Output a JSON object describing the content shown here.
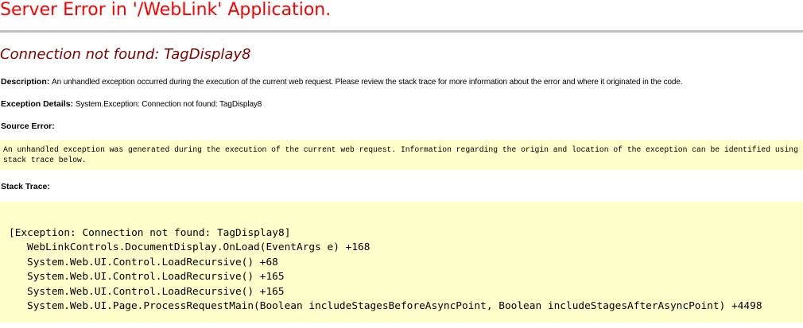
{
  "app_title": "Server Error in '/WebLink' Application.",
  "error_heading": "Connection not found: TagDisplay8",
  "description": {
    "label": "Description:",
    "text": "An unhandled exception occurred during the execution of the current web request. Please review the stack trace for more information about the error and where it originated in the code."
  },
  "exception_details": {
    "label": "Exception Details:",
    "text": "System.Exception: Connection not found: TagDisplay8"
  },
  "source_error": {
    "label": "Source Error:",
    "text": "An unhandled exception was generated during the execution of the current web request. Information regarding the origin and location of the exception can be identified using the exception stack trace below."
  },
  "stack_trace": {
    "label": "Stack Trace:",
    "exception_line": "[Exception: Connection not found: TagDisplay8]",
    "frames": [
      "WebLinkControls.DocumentDisplay.OnLoad(EventArgs e) +168",
      "System.Web.UI.Control.LoadRecursive() +68",
      "System.Web.UI.Control.LoadRecursive() +165",
      "System.Web.UI.Control.LoadRecursive() +165",
      "System.Web.UI.Page.ProcessRequestMain(Boolean includeStagesBeforeAsyncPoint, Boolean includeStagesAfterAsyncPoint) +4498"
    ]
  },
  "colors": {
    "title": "#ff0000",
    "heading": "#800000",
    "rule": "#c0c0c0",
    "code_background": "#ffffcc"
  }
}
